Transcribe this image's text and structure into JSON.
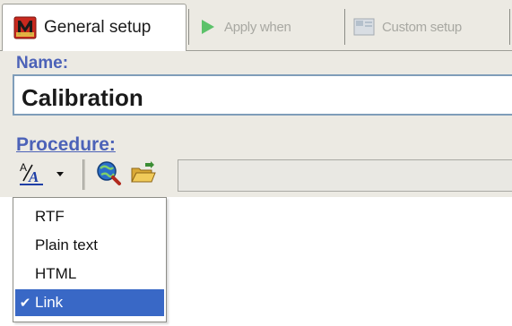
{
  "tabs": [
    {
      "label": "General setup",
      "icon": "m-logo-icon",
      "active": true
    },
    {
      "label": "Apply when",
      "icon": "play-icon",
      "active": false
    },
    {
      "label": "Custom setup",
      "icon": "custom-setup-icon",
      "active": false
    }
  ],
  "name": {
    "label": "Name:",
    "value": "Calibration"
  },
  "procedure": {
    "label": "Procedure:"
  },
  "toolbar": {
    "format_icon": "text-format-icon",
    "dropdown_icon": "dropdown-arrow-icon",
    "globe_icon": "globe-search-icon",
    "folder_icon": "open-folder-icon",
    "path_value": ""
  },
  "format_menu": {
    "items": [
      {
        "label": "RTF",
        "checked": false
      },
      {
        "label": "Plain text",
        "checked": false
      },
      {
        "label": "HTML",
        "checked": false
      },
      {
        "label": "Link",
        "checked": true
      }
    ],
    "check_glyph": "✔"
  },
  "colors": {
    "label": "#4c62b8",
    "selection": "#3968c6"
  }
}
